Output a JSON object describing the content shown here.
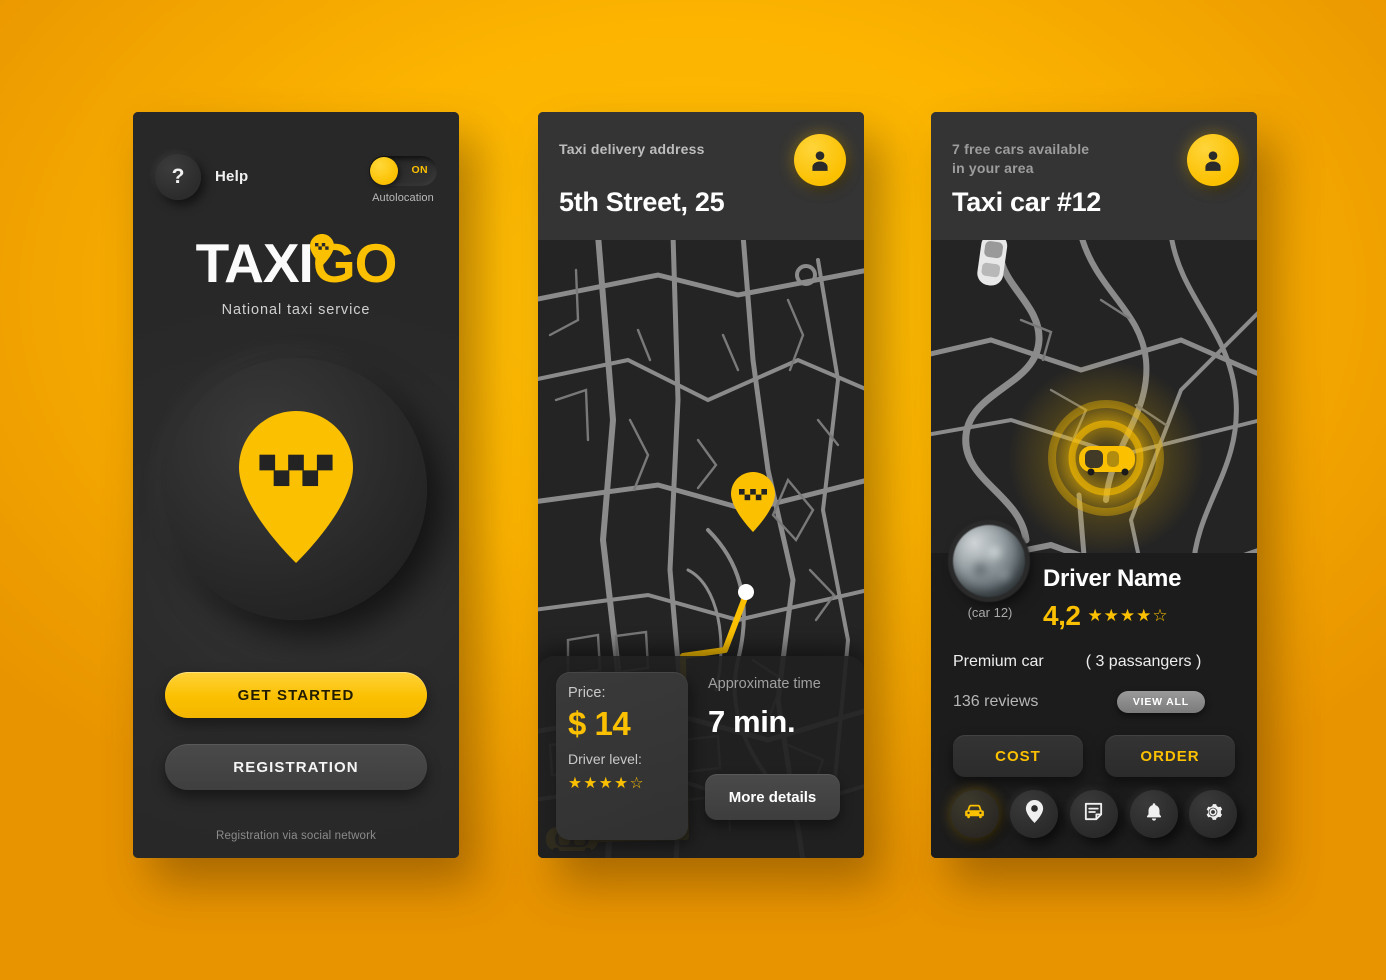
{
  "background_color": "#FCB400",
  "accent_color": "#FBC000",
  "screen1": {
    "help_icon": "question-mark-icon",
    "help_label": "Help",
    "toggle_state_label": "ON",
    "toggle_caption": "Autolocation",
    "logo_part1": "TAXI",
    "logo_part2": "GO",
    "logo_pin_icon": "taxi-pin-icon",
    "tagline": "National taxi service",
    "hero_icon": "taxi-checker-pin-icon",
    "primary_button": "GET STARTED",
    "secondary_button": "REGISTRATION",
    "footer_note": "Registration via social network"
  },
  "screen2": {
    "header_subtitle": "Taxi delivery address",
    "header_title": "5th Street, 25",
    "avatar_icon": "user-avatar-icon",
    "map": {
      "destination_pin_icon": "taxi-pin-icon",
      "origin_car_icon": "taxi-car-top-icon",
      "waypoint_icon": "route-waypoint-dot"
    },
    "price_label": "Price:",
    "price_value": "$ 14",
    "driver_level_label": "Driver level:",
    "driver_level_stars_filled": 4,
    "driver_level_stars_total": 5,
    "approx_time_label": "Approximate time",
    "approx_time_value": "7 min.",
    "more_details_button": "More details"
  },
  "screen3": {
    "header_subtitle": "7 free cars available\nin your area",
    "header_subtitle_line1": "7 free cars available",
    "header_subtitle_line2": "in your area",
    "header_title": "Taxi car #12",
    "avatar_icon": "user-avatar-icon",
    "map": {
      "active_car_icon": "taxi-car-top-icon",
      "other_car_icons": [
        "white-car-top-icon",
        "white-car-top-icon"
      ],
      "radar_glow": true
    },
    "driver_photo_alt": "driver-photo",
    "car_id": "(car 12)",
    "driver_name": "Driver Name",
    "rating_value": "4,2",
    "rating_stars_filled": 4,
    "rating_stars_total": 5,
    "car_class": "Premium car",
    "passengers": "( 3 passangers )",
    "reviews": "136 reviews",
    "view_all_button": "VIEW ALL",
    "cost_button": "COST",
    "order_button": "ORDER",
    "nav_items": [
      {
        "icon": "car-icon",
        "active": true
      },
      {
        "icon": "location-pin-icon",
        "active": false
      },
      {
        "icon": "message-document-icon",
        "active": false
      },
      {
        "icon": "bell-icon",
        "active": false
      },
      {
        "icon": "gear-icon",
        "active": false
      }
    ]
  }
}
